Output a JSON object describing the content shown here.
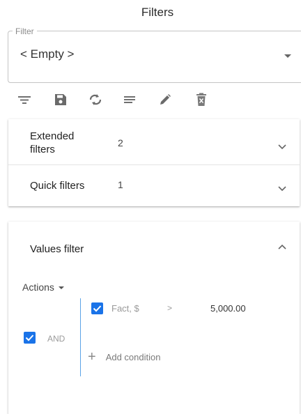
{
  "header": {
    "title": "Filters"
  },
  "filter_select": {
    "legend": "Filter",
    "value": "< Empty >"
  },
  "toolbar": {
    "icons": [
      "filter-list-icon",
      "save-icon",
      "refresh-icon",
      "lines-icon",
      "edit-icon",
      "delete-icon"
    ]
  },
  "panels": {
    "extended": {
      "label": "Extended filters",
      "count": "2"
    },
    "quick": {
      "label": "Quick filters",
      "count": "1"
    }
  },
  "values_filter": {
    "title": "Values filter",
    "actions_label": "Actions",
    "group_operator": "AND",
    "condition": {
      "field": "Fact, $",
      "operator": ">",
      "value": "5,000.00"
    },
    "add_condition_label": "Add condition"
  },
  "colors": {
    "accent": "#1a73e8",
    "line": "#5aa3e6"
  }
}
